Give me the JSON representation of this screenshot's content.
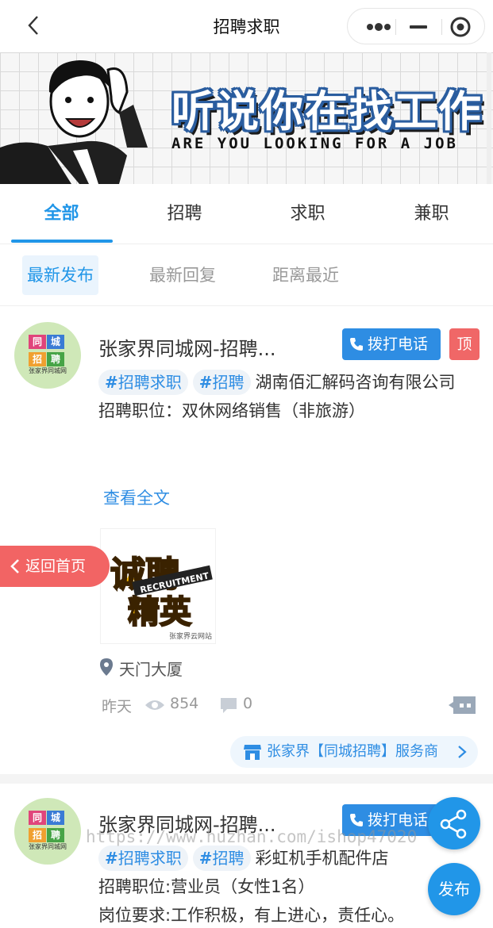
{
  "navbar": {
    "title": "招聘求职"
  },
  "banner": {
    "title": "听说你在找工作",
    "subtitle": "ARE YOU LOOKING FOR A JOB"
  },
  "tabs": [
    {
      "label": "全部",
      "active": true
    },
    {
      "label": "招聘",
      "active": false
    },
    {
      "label": "求职",
      "active": false
    },
    {
      "label": "兼职",
      "active": false
    }
  ],
  "sort": [
    {
      "label": "最新发布",
      "active": true
    },
    {
      "label": "最新回复",
      "active": false
    },
    {
      "label": "距离最近",
      "active": false
    }
  ],
  "avatar": {
    "cells": [
      "同",
      "城",
      "招",
      "聘"
    ],
    "footer": "张家界同城网"
  },
  "posts": [
    {
      "title": "张家界同城网-招聘...",
      "call_label": "拨打电话",
      "top_label": "顶",
      "tags": [
        "招聘求职",
        "招聘"
      ],
      "company": "湖南佰汇解码咨询有限公司",
      "position": "招聘职位：双休网络销售（非旅游）",
      "fulltext_label": "查看全文",
      "image_text": {
        "line1": "诚聘",
        "line2": "精英",
        "english": "RECRUITMENT",
        "caption": "张家界云网站"
      },
      "location": "天门大厦",
      "time": "昨天",
      "views": "854",
      "comments": "0",
      "service_label": "张家界【同城招聘】服务商"
    },
    {
      "title": "张家界同城网-招聘...",
      "call_label": "拨打电话",
      "tags": [
        "招聘求职",
        "招聘"
      ],
      "company": "彩虹机手机配件店",
      "position": "招聘职位:营业员（女性1名）",
      "requirement": "岗位要求:工作积极，有上进心，责任心。"
    }
  ],
  "floating": {
    "home_label": "返回首页",
    "publish_label": "发布"
  },
  "watermark": "https://www.huzhan.com/ishop47020",
  "colors": {
    "accent": "#2196e8",
    "danger": "#f06767",
    "tag_bg": "#eef3f8"
  }
}
